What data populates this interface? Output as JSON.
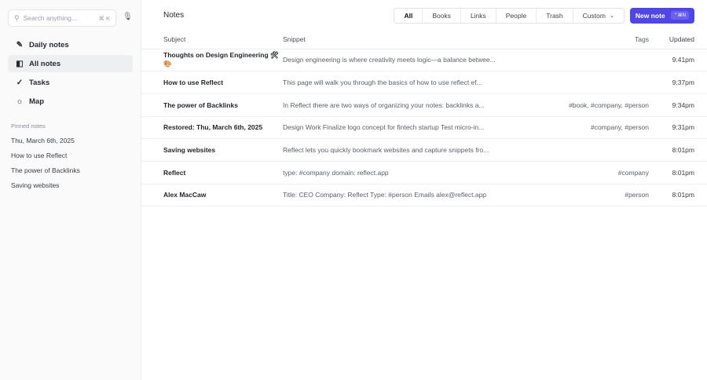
{
  "sidebar": {
    "search_placeholder": "Search anything...",
    "search_shortcut": "⌘ K",
    "nav": [
      {
        "label": "Daily notes",
        "icon": "pencil-icon"
      },
      {
        "label": "All notes",
        "icon": "note-icon",
        "active": true
      },
      {
        "label": "Tasks",
        "icon": "check-circle-icon"
      },
      {
        "label": "Map",
        "icon": "sun-map-icon"
      }
    ],
    "pinned_title": "Pinned notes",
    "pinned": [
      "Thu, March 6th, 2025",
      "How to use Reflect",
      "The power of Backlinks",
      "Saving websites"
    ]
  },
  "header": {
    "title": "Notes",
    "filters": [
      "All",
      "Books",
      "Links",
      "People",
      "Trash",
      "Custom"
    ],
    "active_filter": "All",
    "new_note": "New note",
    "new_note_shortcut": "⌃⌘N"
  },
  "table": {
    "columns": {
      "subject": "Subject",
      "snippet": "Snippet",
      "tags": "Tags",
      "updated": "Updated"
    },
    "rows": [
      {
        "subject": "Thoughts on Design Engineering 🛠🎨",
        "snippet": "Design engineering is where creativity meets logic—a balance betwee...",
        "tags": "",
        "updated": "9:41pm"
      },
      {
        "subject": "How to use Reflect",
        "snippet": "This page will walk you through the basics of how to use reflect ef...",
        "tags": "",
        "updated": "9:37pm"
      },
      {
        "subject": "The power of Backlinks",
        "snippet": "In Reflect there are two ways of organizing your notes: backlinks a...",
        "tags": "#book, #company, #person",
        "updated": "9:34pm"
      },
      {
        "subject": "Restored: Thu, March 6th, 2025",
        "snippet": "Design Work Finalize logo concept for fintech startup Test micro-in...",
        "tags": "#company, #person",
        "updated": "9:31pm"
      },
      {
        "subject": "Saving websites",
        "snippet": "Reflect lets you quickly bookmark websites and capture snippets fro...",
        "tags": "",
        "updated": "8:01pm"
      },
      {
        "subject": "Reflect",
        "snippet": "type: #company domain: reflect.app",
        "tags": "#company",
        "updated": "8:01pm"
      },
      {
        "subject": "Alex MacCaw",
        "snippet": "Title: CEO Company: Reflect Type: #person Emails alex@reflect.app",
        "tags": "#person",
        "updated": "8:01pm"
      }
    ]
  }
}
